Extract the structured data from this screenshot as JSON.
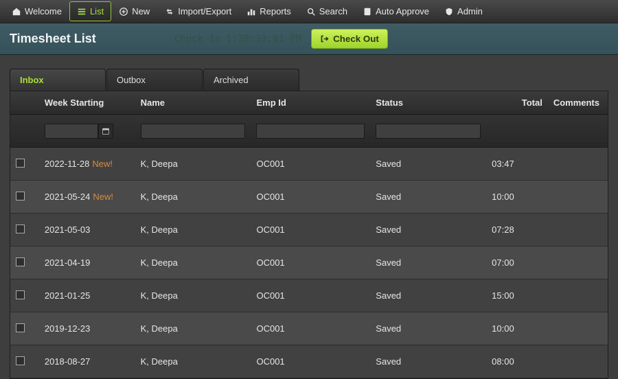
{
  "nav": {
    "welcome": "Welcome",
    "list": "List",
    "new": "New",
    "import_export": "Import/Export",
    "reports": "Reports",
    "search": "Search",
    "auto_approve": "Auto Approve",
    "admin": "Admin"
  },
  "header": {
    "title": "Timesheet List",
    "clock": "Check In 1:38:33:01 PM",
    "checkout_label": "Check Out"
  },
  "tabs": {
    "inbox": "Inbox",
    "outbox": "Outbox",
    "archived": "Archived"
  },
  "columns": {
    "week": "Week Starting",
    "name": "Name",
    "emp": "Emp Id",
    "status": "Status",
    "total": "Total",
    "comments": "Comments"
  },
  "filters": {
    "week": "",
    "name": "",
    "emp": "",
    "status": ""
  },
  "new_tag": "New!",
  "rows": [
    {
      "week": "2022-11-28",
      "is_new": true,
      "name": "K, Deepa",
      "emp": "OC001",
      "status": "Saved",
      "total": "03:47"
    },
    {
      "week": "2021-05-24",
      "is_new": true,
      "name": "K, Deepa",
      "emp": "OC001",
      "status": "Saved",
      "total": "10:00"
    },
    {
      "week": "2021-05-03",
      "is_new": false,
      "name": "K, Deepa",
      "emp": "OC001",
      "status": "Saved",
      "total": "07:28"
    },
    {
      "week": "2021-04-19",
      "is_new": false,
      "name": "K, Deepa",
      "emp": "OC001",
      "status": "Saved",
      "total": "07:00"
    },
    {
      "week": "2021-01-25",
      "is_new": false,
      "name": "K, Deepa",
      "emp": "OC001",
      "status": "Saved",
      "total": "15:00"
    },
    {
      "week": "2019-12-23",
      "is_new": false,
      "name": "K, Deepa",
      "emp": "OC001",
      "status": "Saved",
      "total": "10:00"
    },
    {
      "week": "2018-08-27",
      "is_new": false,
      "name": "K, Deepa",
      "emp": "OC001",
      "status": "Saved",
      "total": "08:00"
    }
  ]
}
